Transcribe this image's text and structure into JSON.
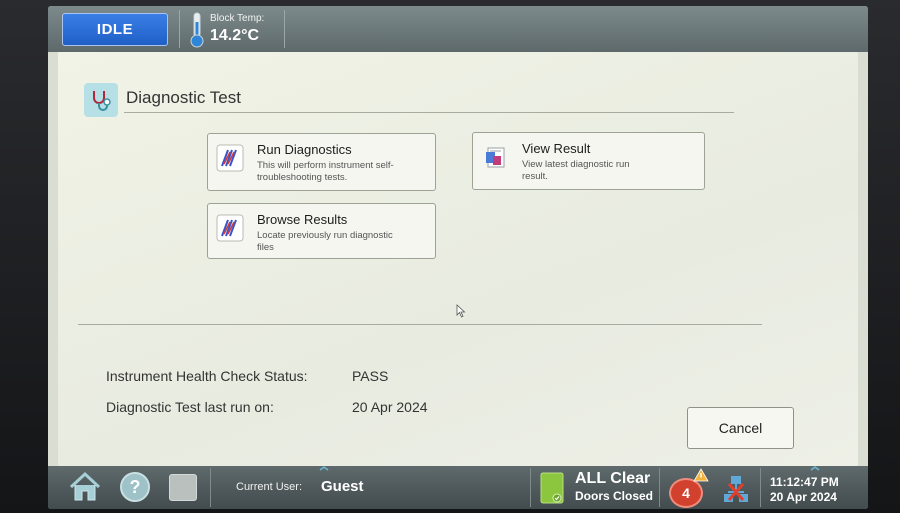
{
  "header": {
    "status_button": "IDLE",
    "block_temp_label": "Block Temp:",
    "block_temp_value": "14.2°C"
  },
  "page": {
    "title": "Diagnostic Test"
  },
  "cards": [
    {
      "title": "Run Diagnostics",
      "description": "This will perform instrument self-troubleshooting tests.",
      "icon": "diagnostics-chart-icon"
    },
    {
      "title": "View Result",
      "description": "View latest diagnostic run result.",
      "icon": "report-icon"
    },
    {
      "title": "Browse Results",
      "description": "Locate previously run diagnostic files",
      "icon": "diagnostics-chart-icon"
    }
  ],
  "status": {
    "health_check_label": "Instrument Health Check Status:",
    "health_check_value": "PASS",
    "last_run_label": "Diagnostic Test last run on:",
    "last_run_value": "20 Apr 2024"
  },
  "actions": {
    "cancel_label": "Cancel"
  },
  "footer": {
    "current_user_label": "Current User:",
    "current_user_value": "Guest",
    "doors_title": "ALL Clear",
    "doors_subtitle": "Doors Closed",
    "alert_count": "4",
    "time": "11:12:47 PM",
    "date": "20 Apr 2024"
  },
  "colors": {
    "idle_button": "#2a6fd8",
    "panel_background": "#eef0e6",
    "alert_badge": "#d2402e",
    "door_status": "#8cc63f"
  }
}
